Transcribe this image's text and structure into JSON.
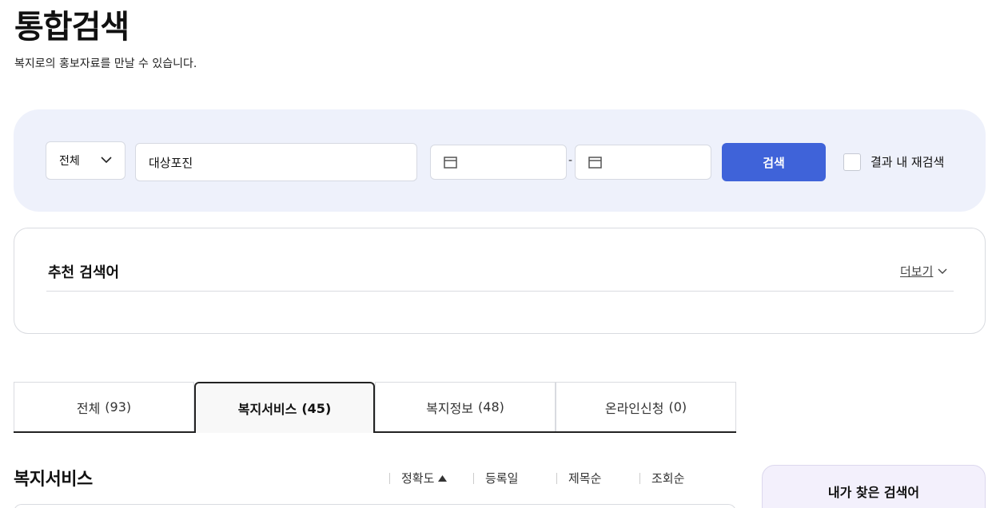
{
  "header": {
    "title": "통합검색",
    "description": "복지로의 홍보자료를 만날 수 있습니다."
  },
  "search": {
    "category_selected": "전체",
    "keyword_value": "대상포진",
    "date_separator": "-",
    "search_button": "검색",
    "research_label": "결과 내 재검색",
    "accent_color": "#3f63d9"
  },
  "recommend": {
    "title": "추천 검색어",
    "more_label": "더보기"
  },
  "tabs": [
    {
      "label": "전체",
      "count": "(93)",
      "active": false
    },
    {
      "label": "복지서비스",
      "count": "(45)",
      "active": true
    },
    {
      "label": "복지정보",
      "count": "(48)",
      "active": false
    },
    {
      "label": "온라인신청",
      "count": "(0)",
      "active": false
    }
  ],
  "results": {
    "section_title": "복지서비스",
    "sort_options": [
      "정확도",
      "등록일",
      "제목순",
      "조회순"
    ]
  },
  "sidebar": {
    "my_searches_title": "내가 찾은 검색어"
  }
}
